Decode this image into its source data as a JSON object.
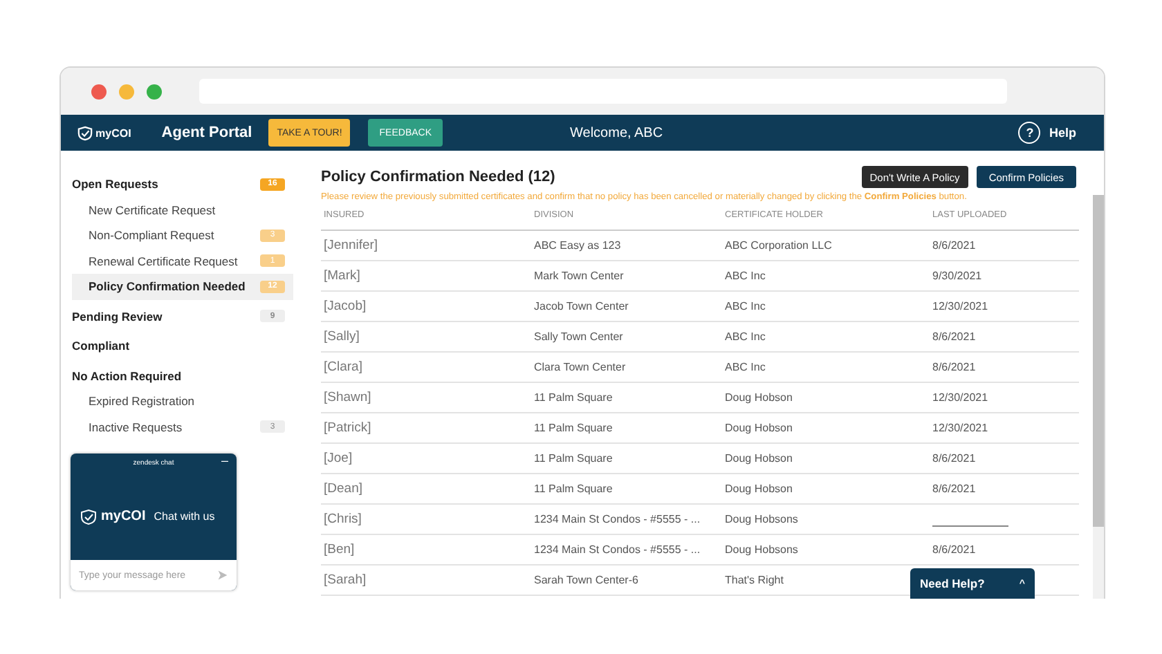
{
  "nav": {
    "logo": "myCOI",
    "portal": "Agent Portal",
    "tour_button": "TAKE A TOUR!",
    "feedback_button": "FEEDBACK",
    "welcome": "Welcome, ABC",
    "help_icon": "?",
    "help": "Help"
  },
  "sidebar": {
    "groups": [
      {
        "label": "Open Requests",
        "badge": "16",
        "color": "#f5a623",
        "selected": false,
        "children": [
          {
            "label": "New Certificate Request",
            "selected": false
          },
          {
            "label": "Non-Compliant Request",
            "badge": "3",
            "color": "#f9cf8a",
            "selected": false
          },
          {
            "label": "Renewal Certificate Request",
            "badge": "1",
            "color": "#f9cf8a",
            "selected": false
          },
          {
            "label": "Policy Confirmation Needed",
            "badge": "12",
            "color": "#f9cf8a",
            "selected": true
          }
        ]
      },
      {
        "label": "Pending Review",
        "badge": "9",
        "color": "#eeeeee",
        "selected": false
      },
      {
        "label": "Compliant",
        "selected": false
      },
      {
        "label": "No Action Required",
        "selected": false,
        "children": [
          {
            "label": "Expired Registration",
            "selected": false
          },
          {
            "label": "Inactive Requests",
            "badge": "3",
            "color": "#eeeeee",
            "selected": false
          }
        ]
      }
    ]
  },
  "chat": {
    "header": "zendesk chat",
    "minimize": "–",
    "logo": "myCOI",
    "title": "Chat with us",
    "placeholder": "Type your message here"
  },
  "main": {
    "title": "Policy Confirmation Needed (12)",
    "buttons": [
      {
        "label": "Don't Write A Policy",
        "kind": "dark"
      },
      {
        "label": "Confirm Policies",
        "kind": "primary"
      }
    ],
    "notice": "Please review the previously submitted certificates and confirm that no policy has been cancelled or materially changed by clicking the **Confirm Policies** button."
  },
  "table": {
    "columns": [
      "INSURED",
      "DIVISION",
      "CERTIFICATE HOLDER",
      "LAST UPLOADED"
    ],
    "rows": [
      {
        "insured": "[Jennifer]",
        "division": "ABC Easy as 123",
        "holder": "ABC Corporation LLC",
        "last_uploaded": "8/6/2021",
        "date_blank": false
      },
      {
        "insured": "[Mark]",
        "division": "Mark Town Center",
        "holder": "ABC Inc",
        "last_uploaded": "9/30/2021",
        "date_blank": false
      },
      {
        "insured": "[Jacob]",
        "division": "Jacob Town Center",
        "holder": "ABC Inc",
        "last_uploaded": "12/30/2021",
        "date_blank": false
      },
      {
        "insured": "[Sally]",
        "division": "Sally Town Center",
        "holder": "ABC Inc",
        "last_uploaded": "8/6/2021",
        "date_blank": false
      },
      {
        "insured": "[Clara]",
        "division": "Clara Town Center",
        "holder": "ABC Inc",
        "last_uploaded": "8/6/2021",
        "date_blank": false
      },
      {
        "insured": "[Shawn]",
        "division": "11 Palm Square",
        "holder": "Doug Hobson",
        "last_uploaded": "12/30/2021",
        "date_blank": false
      },
      {
        "insured": "[Patrick]",
        "division": "11 Palm Square",
        "holder": "Doug Hobson",
        "last_uploaded": "12/30/2021",
        "date_blank": false
      },
      {
        "insured": "[Joe]",
        "division": "11 Palm Square",
        "holder": "Doug Hobson",
        "last_uploaded": "8/6/2021",
        "date_blank": false
      },
      {
        "insured": "[Dean]",
        "division": "11 Palm Square",
        "holder": "Doug Hobson",
        "last_uploaded": "8/6/2021",
        "date_blank": false
      },
      {
        "insured": "[Chris]",
        "division": "1234 Main St Condos - #5555 - ...",
        "holder": "Doug Hobsons",
        "date_blank": true
      },
      {
        "insured": "[Ben]",
        "division": "1234 Main St Condos - #5555 - ...",
        "holder": "Doug Hobsons",
        "last_uploaded": "8/6/2021",
        "date_blank": false
      },
      {
        "insured": "[Sarah]",
        "division": "Sarah Town Center-6",
        "holder": "That's Right",
        "date_blank": false
      }
    ]
  },
  "help_widget": {
    "label": "Need Help?",
    "caret": "^"
  }
}
